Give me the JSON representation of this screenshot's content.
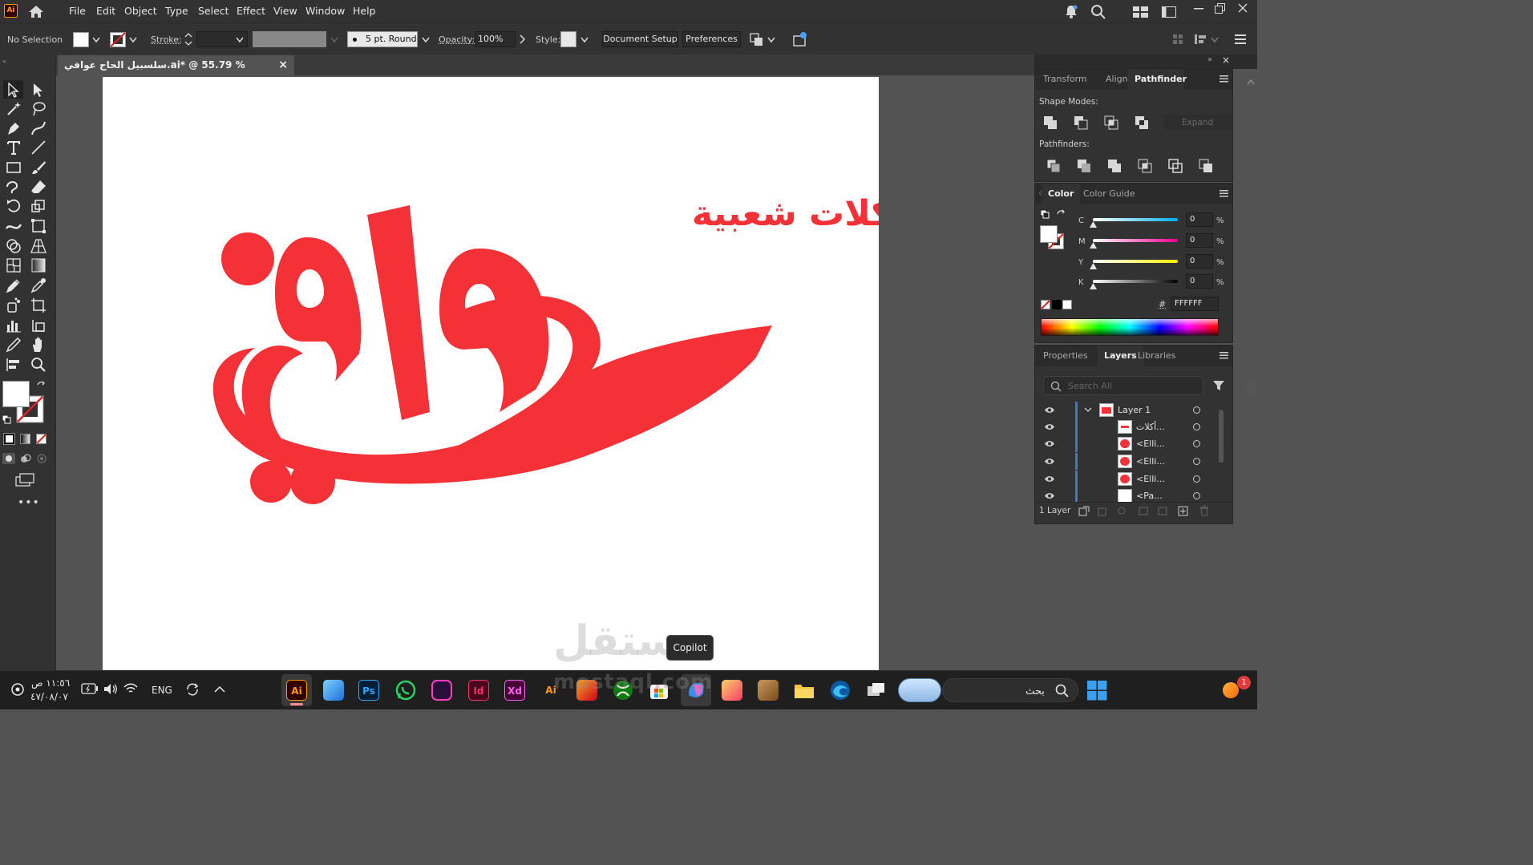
{
  "app": {
    "logo": "Ai",
    "menu": [
      "File",
      "Edit",
      "Object",
      "Type",
      "Select",
      "Effect",
      "View",
      "Window",
      "Help"
    ],
    "home_icon": "home-icon"
  },
  "control_bar": {
    "selection": "No Selection",
    "stroke_label": "Stroke:",
    "brush": "5 pt. Round",
    "opacity_label": "Opacity:",
    "opacity_value": "100%",
    "style_label": "Style:",
    "document_setup": "Document Setup",
    "preferences": "Preferences"
  },
  "document_tab": {
    "title": "سلسبيل الحاج عوافي.ai* @ 55.79 % (RGB/Preview)",
    "close": "×"
  },
  "artwork": {
    "tagline": "أكلات شعبية",
    "brand_color": "#f33136"
  },
  "pathfinder_panel": {
    "tabs": [
      "Transform",
      "Align",
      "Pathfinder"
    ],
    "active_tab": "Pathfinder",
    "shape_modes_label": "Shape Modes:",
    "expand_label": "Expand",
    "pathfinders_label": "Pathfinders:"
  },
  "color_panel": {
    "tabs": [
      "Color",
      "Color Guide"
    ],
    "active_tab": "Color",
    "channels": [
      {
        "label": "C",
        "value": "0",
        "unit": "%"
      },
      {
        "label": "M",
        "value": "0",
        "unit": "%"
      },
      {
        "label": "Y",
        "value": "0",
        "unit": "%"
      },
      {
        "label": "K",
        "value": "0",
        "unit": "%"
      }
    ],
    "hex_label": "#",
    "hex_value": "FFFFFF"
  },
  "layers_panel": {
    "tabs": [
      "Properties",
      "Layers",
      "Libraries"
    ],
    "active_tab": "Layers",
    "search_placeholder": "Search All",
    "layer": "Layer 1",
    "items": [
      "أكلات...",
      "<Elli...",
      "<Elli...",
      "<Elli...",
      "<Pa..."
    ],
    "footer": "1 Layer"
  },
  "taskbar": {
    "time": "١١:٥٦ ص",
    "date": "٤٧/٠٨/٠٧",
    "lang": "ENG",
    "search_label": "بحث",
    "tooltip": "Copilot",
    "notification_count": "1",
    "apps": [
      {
        "label": "Ai",
        "color": "#ff9a00",
        "bg": "#330000"
      },
      {
        "label": "",
        "color": "#4aa3ff",
        "bg": "#1f4f8a"
      },
      {
        "label": "Ps",
        "color": "#31a8ff",
        "bg": "#001e36"
      },
      {
        "label": "",
        "color": "#25d366",
        "bg": "#1f1f1f"
      },
      {
        "label": "",
        "color": "#ff3ebf",
        "bg": "#2a0e3a"
      },
      {
        "label": "Id",
        "color": "#ff3366",
        "bg": "#49021f"
      },
      {
        "label": "Xd",
        "color": "#ff61f6",
        "bg": "#470137"
      },
      {
        "label": "Ai",
        "color": "#ff9a00",
        "bg": "#330000"
      }
    ]
  },
  "watermark": {
    "arabic": "مستقل",
    "latin": "mostaql.com"
  }
}
